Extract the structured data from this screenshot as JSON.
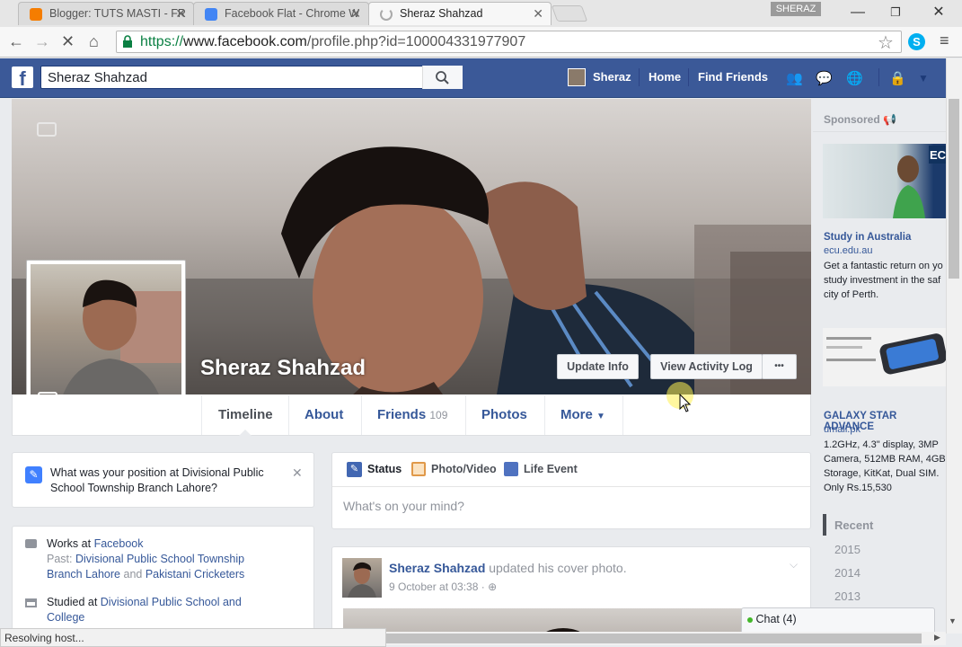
{
  "browser": {
    "tabs": [
      {
        "title": "Blogger: TUTS MASTI - FR",
        "icon_color": "#f57d00"
      },
      {
        "title": "Facebook Flat - Chrome W",
        "icon_color": "#4285f4"
      },
      {
        "title": "Sheraz Shahzad",
        "icon_color": "#999999"
      }
    ],
    "user_badge": "SHERAZ",
    "url_scheme": "https://",
    "url_host": "www.facebook.com",
    "url_path": "/profile.php?id=100004331977907",
    "status": "Resolving host..."
  },
  "fb": {
    "logo": "f",
    "search_value": "Sheraz Shahzad",
    "nav_user": "Sheraz",
    "nav_home": "Home",
    "nav_find_friends": "Find Friends",
    "brand_color": "#3b5998"
  },
  "profile": {
    "name": "Sheraz Shahzad",
    "update_info": "Update Info",
    "view_activity_log": "View Activity Log",
    "more_dots": "•••",
    "tabs": {
      "timeline": "Timeline",
      "about": "About",
      "friends": "Friends",
      "friends_count": "109",
      "photos": "Photos",
      "more": "More"
    }
  },
  "left": {
    "question": "What was your position at Divisional Public School Township Branch Lahore?",
    "works_prefix": "Works at",
    "works_link": "Facebook",
    "past_prefix": "Past:",
    "past_link1": "Divisional Public School Township Branch Lahore",
    "past_and": "and",
    "past_link2": "Pakistani Cricketers",
    "studied_prefix": "Studied at",
    "studied_link": "Divisional Public School and College"
  },
  "composer": {
    "status": "Status",
    "photo_video": "Photo/Video",
    "life_event": "Life Event",
    "placeholder": "What's on your mind?"
  },
  "post": {
    "author": "Sheraz Shahzad",
    "action": "updated his cover photo.",
    "time": "9 October at 03:38 ·"
  },
  "sidebar": {
    "sponsored": "Sponsored",
    "ad1_title": "Study in Australia",
    "ad1_host": "ecu.edu.au",
    "ad1_text": "Get a fantastic return on yo study investment in the saf city of Perth.",
    "ad2_title": "GALAXY STAR ADVANCE",
    "ad2_host": "umall.pk",
    "ad2_text": "1.2GHz, 4.3\" display, 3MP Camera, 512MB RAM, 4GB Storage, KitKat, Dual SIM. Only Rs.15,530",
    "years": [
      "Recent",
      "2015",
      "2014",
      "2013"
    ]
  },
  "chat": {
    "label": "Chat (4)"
  }
}
